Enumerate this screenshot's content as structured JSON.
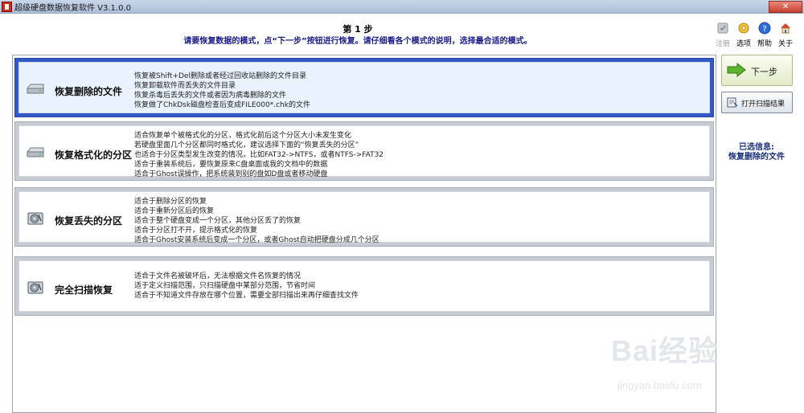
{
  "window": {
    "title": "超级硬盘数据恢复软件 V3.1.0.0",
    "close_label": "✕"
  },
  "header": {
    "step_title": "第 1 步",
    "step_desc": "请要恢复数据的模式，点“下一步”按钮进行恢复。请仔细看各个模式的说明，选择最合适的模式。"
  },
  "toolbar": {
    "register": "注册",
    "options": "选项",
    "help": "帮助",
    "close": "关于"
  },
  "modes": [
    {
      "title": "恢复删除的文件",
      "selected": true,
      "lines": [
        "恢复被Shift+Del删除或者经过回收站删除的文件目录",
        "恢复卸载软件而丢失的文件目录",
        "恢复杀毒后丢失的文件或者因为病毒删除的文件",
        "恢复做了ChkDsk磁盘检查后变成FILE000*.chk的文件"
      ]
    },
    {
      "title": "恢复格式化的分区",
      "selected": false,
      "lines": [
        "适合恢复单个被格式化的分区，格式化前后这个分区大小未发生变化",
        "若硬盘里面几个分区都同时格式化，建议选择下面的“恢复丢失的分区”",
        "也适合于分区类型发生改变的情况，比如FAT32->NTFS，或者NTFS->FAT32",
        "适合于重装系统后，要恢复原来C盘桌面或我的文档中的数据",
        "适合于Ghost误操作，把系统装到别的盘如D盘或者移动硬盘"
      ]
    },
    {
      "title": "恢复丢失的分区",
      "selected": false,
      "lines": [
        "适合于删除分区的恢复",
        "适合于重新分区后的恢复",
        "适合于整个硬盘变成一个分区，其他分区丢了的恢复",
        "适合于分区打不开，提示格式化的恢复",
        "适合于Ghost安装系统后变成一个分区，或者Ghost自动把硬盘分成几个分区"
      ]
    },
    {
      "title": "完全扫描恢复",
      "selected": false,
      "lines": [
        "适合于文件名被破坏后，无法根据文件名恢复的情况",
        "适于定义扫描范围，只扫描硬盘中某部分范围，节省时间",
        "适合于不知道文件存放在哪个位置，需要全部扫描出来再仔细查找文件"
      ]
    }
  ],
  "actions": {
    "next_label": "下一步",
    "open_scan_label": "打开扫描结果"
  },
  "selection": {
    "label": "已选信息:",
    "value": "恢复删除的文件"
  },
  "watermark": {
    "brand": "Bai经验",
    "url": "jingyan.baidu.com"
  },
  "icons": {
    "mode_drive": "hard-drive-icon",
    "next": "green-arrow-icon",
    "open": "open-scan-icon"
  }
}
